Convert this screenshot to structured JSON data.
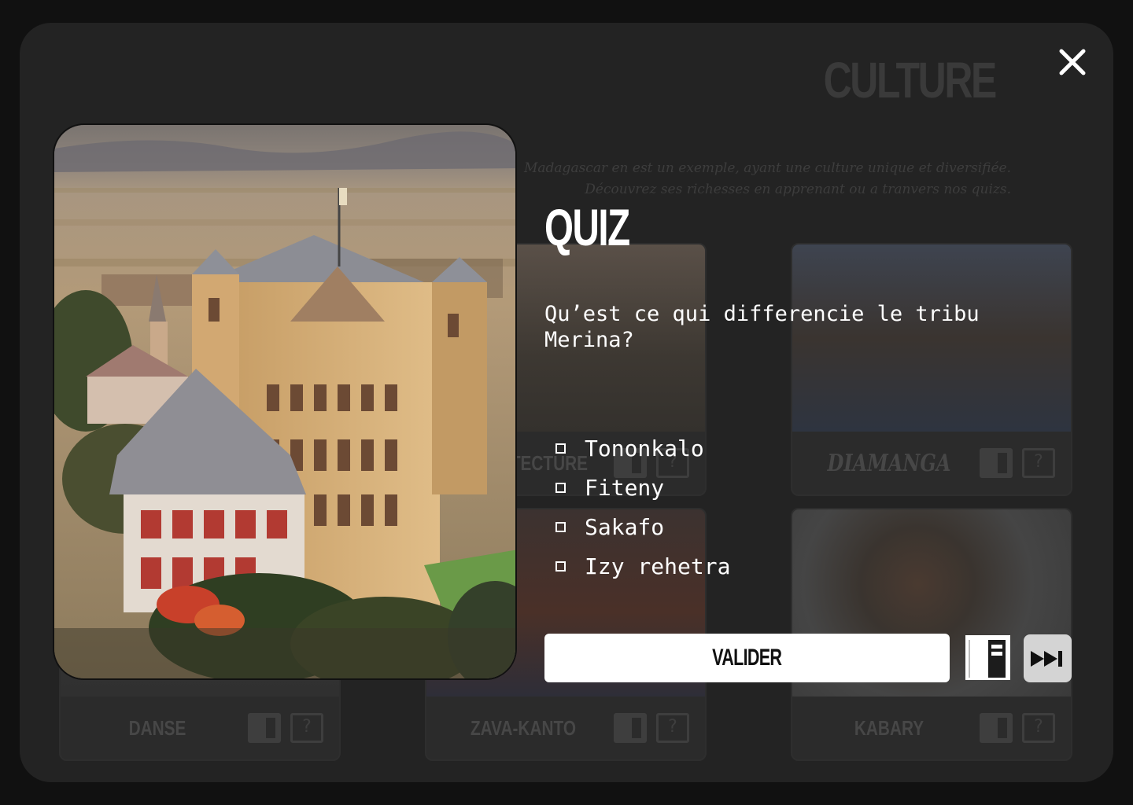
{
  "background": {
    "section_title": "CULTURE",
    "intro_line1": "Madagascar en est un exemple, ayant une culture unique et diversifiée.",
    "intro_line2": "Découvrez ses richesses en apprenant ou a tranvers nos quizs.",
    "cards": [
      {
        "label": "ARCHITECTURE"
      },
      {
        "label": "DIAMANGA"
      },
      {
        "label": "DANSE"
      },
      {
        "label": "ZAVA-KANTO"
      },
      {
        "label": "KABARY"
      }
    ]
  },
  "modal": {
    "title": "QUIZ",
    "question": "Qu’est ce qui differencie le tribu Merina?",
    "options": [
      {
        "label": "Tononkalo",
        "checked": false
      },
      {
        "label": "Fiteny",
        "checked": false
      },
      {
        "label": "Sakafo",
        "checked": false
      },
      {
        "label": "Izy rehetra",
        "checked": false
      }
    ],
    "validate_label": "VALIDER",
    "icons": {
      "close": "close-icon",
      "book": "book-icon",
      "skip": "skip-forward-icon"
    }
  },
  "colors": {
    "frame": "#232323",
    "page": "#111111",
    "text": "#ffffff",
    "skip_button": "#d4d4d4"
  }
}
